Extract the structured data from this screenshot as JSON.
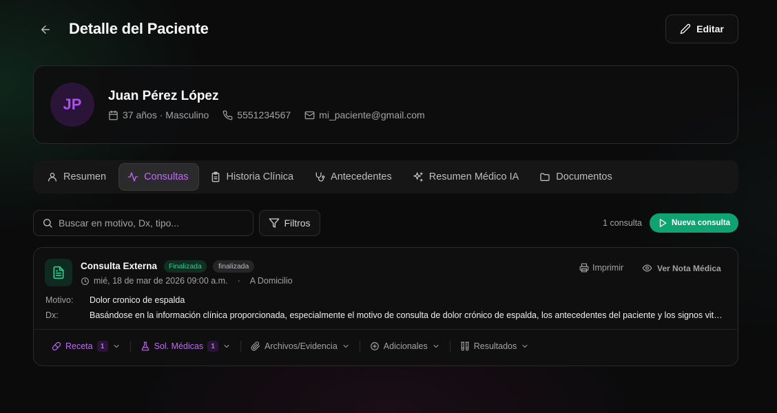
{
  "header": {
    "title": "Detalle del Paciente",
    "edit_label": "Editar"
  },
  "patient": {
    "initials": "JP",
    "name": "Juan Pérez López",
    "age_gender": "37 años · Masculino",
    "phone": "5551234567",
    "email": "mi_paciente@gmail.com"
  },
  "tabs": [
    {
      "label": "Resumen",
      "icon": "user-icon"
    },
    {
      "label": "Consultas",
      "icon": "activity-icon",
      "active": true
    },
    {
      "label": "Historia Clínica",
      "icon": "clipboard-icon"
    },
    {
      "label": "Antecedentes",
      "icon": "stethoscope-icon"
    },
    {
      "label": "Resumen Médico IA",
      "icon": "sparkles-icon"
    },
    {
      "label": "Documentos",
      "icon": "folder-icon"
    }
  ],
  "search": {
    "placeholder": "Buscar en motivo, Dx, tipo...",
    "value": ""
  },
  "filters_label": "Filtros",
  "consult_count": "1 consulta",
  "new_consult_label": "Nueva consulta",
  "consultation": {
    "title": "Consulta Externa",
    "badge_primary": "Finalizada",
    "badge_status": "finalizada",
    "date": "mié, 18 de mar de 2026 09:00 a.m.",
    "separator": "·",
    "location": "A Domicilio",
    "print_label": "Imprimir",
    "view_note_label": "Ver Nota Médica",
    "motivo_label": "Motivo:",
    "motivo": "Dolor cronico de espalda",
    "dx_label": "Dx:",
    "dx": "Basándose en la información clínica proporcionada, especialmente el motivo de consulta de dolor crónico de espalda, los antecedentes del paciente y los signos vitales registrados, se establece el diagnóstico.",
    "actions": {
      "receta": {
        "label": "Receta",
        "count": "1"
      },
      "sol_medicas": {
        "label": "Sol. Médicas",
        "count": "1"
      },
      "archivos": {
        "label": "Archivos/Evidencia"
      },
      "adicionales": {
        "label": "Adicionales"
      },
      "resultados": {
        "label": "Resultados"
      }
    }
  },
  "colors": {
    "accent_purple": "#c06bf5",
    "accent_green": "#0ea371",
    "background": "#0b0b0c"
  }
}
